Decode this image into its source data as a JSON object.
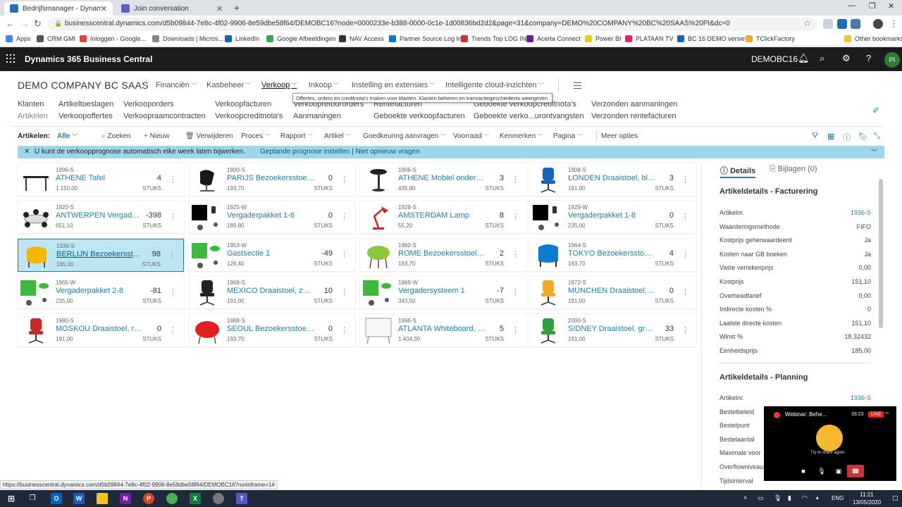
{
  "browser": {
    "tabs": [
      {
        "title": "Bedrijfsmanager - Dynamics 365 B"
      },
      {
        "title": "Join conversation"
      }
    ],
    "url": "businesscentral.dynamics.com/d5b09844-7e8c-4f02-9906-8e59dbe58f64/DEMOBC16?node=0000233e-b388-0000-0c1e-1d00836bd2d2&page=31&company=DEMO%20COMPANY%20BC%20SAAS%20PI&dc=0",
    "bookmarks": [
      "Apps",
      "CRM GMI",
      "Inloggen - Google...",
      "Downloads | Micros...",
      "LinkedIn",
      "Google Afbeeldingen",
      "NAV Access",
      "Partner Source Log In",
      "Trends Top LOG IN",
      "Acerta Connect",
      "Power BI",
      "PLATAAN TV",
      "BC 16 DEMO versie",
      "TClickFactory",
      "Other bookmarks"
    ],
    "status_url": "https://businesscentral.dynamics.com/d5b09844-7e8c-4f02-9906-8e59dbe58f64/DEMOBC16?runinframe=1#"
  },
  "bc": {
    "app_name": "Dynamics 365 Business Central",
    "environment": "DEMOBC16",
    "avatar": "PI"
  },
  "company_name": "DEMO COMPANY BC SAAS",
  "nav": [
    "Financiën",
    "Kasbeheer",
    "Verkoop",
    "Inkoop",
    "Instelling en extensies",
    "Intelligente cloud-inzichten"
  ],
  "tooltip": "Offertes, orders en creditnota's maken voor klanten. Klanten beheren en transactiegeschiedenis weergeven.",
  "sublinks": {
    "row1": [
      "Klanten",
      "Artikeltoeslagen",
      "Verkooporders",
      "Verkoopfacturen",
      "Verkoopretourorders",
      "Rentefacturen",
      "Geboekte verkoopcreditnota's",
      "Verzonden aanmaningen"
    ],
    "row2": [
      "Artikelen",
      "Verkoopoffertes",
      "Verkoopraamcontracten",
      "Verkoopcreditnota's",
      "Aanmaningen",
      "Geboekte verkoopfacturen",
      "Geboekte verko...urontvangsten",
      "Verzonden rentefacturen"
    ]
  },
  "actions": {
    "page_label": "Artikelen:",
    "filter": "Alle",
    "items": [
      "Zoeken",
      "Nieuw",
      "Verwijderen",
      "Proces",
      "Rapport",
      "Artikel",
      "Goedkeuring aanvragen",
      "Voorraad",
      "Kenmerken",
      "Pagina",
      "Meer opties"
    ]
  },
  "notification": {
    "text": "U kunt de verkoopprognose automatisch elke week laten bijwerken.",
    "link": "Geplande prognose instellen | Niet opnieuw vragen"
  },
  "items": [
    {
      "code": "1896-S",
      "name": "ATHENE Tafel",
      "price": "1 150,00",
      "qty": "4",
      "unit": "STUKS",
      "img": "table"
    },
    {
      "code": "1900-S",
      "name": "PARIJS Bezoekersstoel, z...",
      "price": "193,70",
      "qty": "0",
      "unit": "STUKS",
      "img": "chair-black"
    },
    {
      "code": "1906-S",
      "name": "ATHENE Mobiel onderstel",
      "price": "435,80",
      "qty": "3",
      "unit": "STUKS",
      "img": "stand"
    },
    {
      "code": "1908-S",
      "name": "LONDEN Draaistoel, bla...",
      "price": "191,00",
      "qty": "3",
      "unit": "STUKS",
      "img": "office-blue"
    },
    {
      "code": "1920-S",
      "name": "ANTWERPEN Vergadert...",
      "price": "651,10",
      "qty": "-398",
      "unit": "STUKS",
      "img": "meeting"
    },
    {
      "code": "1925-W",
      "name": "Vergaderpakket 1-6",
      "price": "189,80",
      "qty": "0",
      "unit": "STUKS",
      "img": "pack-black"
    },
    {
      "code": "1928-S",
      "name": "AMSTERDAM Lamp",
      "price": "55,20",
      "qty": "8",
      "unit": "STUKS",
      "img": "lamp"
    },
    {
      "code": "1929-W",
      "name": "Vergaderpakket 1-8",
      "price": "235,00",
      "qty": "0",
      "unit": "STUKS",
      "img": "pack-black"
    },
    {
      "code": "1936-S",
      "name": "BERLIJN Bezoekersstoel, ...",
      "price": "185,00",
      "qty": "98",
      "unit": "STUKS",
      "img": "armchair-yellow",
      "selected": true
    },
    {
      "code": "1953-W",
      "name": "Gastsectie 1",
      "price": "126,40",
      "qty": "-49",
      "unit": "STUKS",
      "img": "pack-green"
    },
    {
      "code": "1960-S",
      "name": "ROME Bezoekersstoel, g...",
      "price": "193,70",
      "qty": "2",
      "unit": "STUKS",
      "img": "chair-green"
    },
    {
      "code": "1964-S",
      "name": "TOKYO Bezoekersstoel, ...",
      "price": "193,70",
      "qty": "4",
      "unit": "STUKS",
      "img": "armchair-blue"
    },
    {
      "code": "1965-W",
      "name": "Vergaderpakket 2-8",
      "price": "235,00",
      "qty": "-81",
      "unit": "STUKS",
      "img": "pack-green"
    },
    {
      "code": "1968-S",
      "name": "MEXICO Draaistoel, zwart",
      "price": "191,00",
      "qty": "10",
      "unit": "STUKS",
      "img": "office-black"
    },
    {
      "code": "1969-W",
      "name": "Vergadersysteem 1",
      "price": "343,50",
      "qty": "-7",
      "unit": "STUKS",
      "img": "pack-green"
    },
    {
      "code": "1972-S",
      "name": "MÜNCHEN Draaistoel, g...",
      "price": "191,00",
      "qty": "0",
      "unit": "STUKS",
      "img": "office-yellow"
    },
    {
      "code": "1980-S",
      "name": "MOSKOU Draaistoel, rood",
      "price": "191,00",
      "qty": "0",
      "unit": "STUKS",
      "img": "office-red"
    },
    {
      "code": "1988-S",
      "name": "SEOUL Bezoekersstoel, r...",
      "price": "193,70",
      "qty": "0",
      "unit": "STUKS",
      "img": "chair-red"
    },
    {
      "code": "1996-S",
      "name": "ATLANTA Whiteboard, b...",
      "price": "1 404,30",
      "qty": "5",
      "unit": "STUKS",
      "img": "whiteboard"
    },
    {
      "code": "2000-S",
      "name": "SIDNEY Draaistoel, groen",
      "price": "191,00",
      "qty": "33",
      "unit": "STUKS",
      "img": "office-green"
    }
  ],
  "factbox": {
    "tabs": [
      "Details",
      "Bijlagen (0)"
    ],
    "section1": "Artikeldetails - Facturering",
    "rows1": [
      {
        "k": "Artikelnr.",
        "v": "1936-S",
        "link": true
      },
      {
        "k": "Waarderingsmethode",
        "v": "FIFO"
      },
      {
        "k": "Kostprijs geherwaardeerd",
        "v": "Ja"
      },
      {
        "k": "Kosten naar GB boeken",
        "v": "Ja"
      },
      {
        "k": "Vaste verrekenprijs",
        "v": "0,00"
      },
      {
        "k": "Kostprijs",
        "v": "151,10"
      },
      {
        "k": "Overheadtarief",
        "v": "0,00"
      },
      {
        "k": "Indirecte kosten %",
        "v": "0"
      },
      {
        "k": "Laatste directe kosten",
        "v": "151,10"
      },
      {
        "k": "Winst %",
        "v": "18,32432"
      },
      {
        "k": "Eenheidsprijs",
        "v": "185,00"
      }
    ],
    "section2": "Artikeldetails - Planning",
    "rows2": [
      {
        "k": "Artikelnr.",
        "v": "1936-S",
        "link": true
      },
      {
        "k": "Bestelbeleid",
        "v": ""
      },
      {
        "k": "Bestelpunt",
        "v": ""
      },
      {
        "k": "Bestelaantal",
        "v": ""
      },
      {
        "k": "Maximale voor",
        "v": ""
      },
      {
        "k": "Overflowniveau",
        "v": ""
      },
      {
        "k": "Tijdsinterval",
        "v": ""
      }
    ]
  },
  "webinar": {
    "title": "Webinar: Behe...",
    "time": "33:23",
    "live": "LIVE",
    "share": "Try to share again."
  },
  "taskbar": {
    "lang": "ENG",
    "time": "11:21",
    "date": "13/05/2020"
  }
}
